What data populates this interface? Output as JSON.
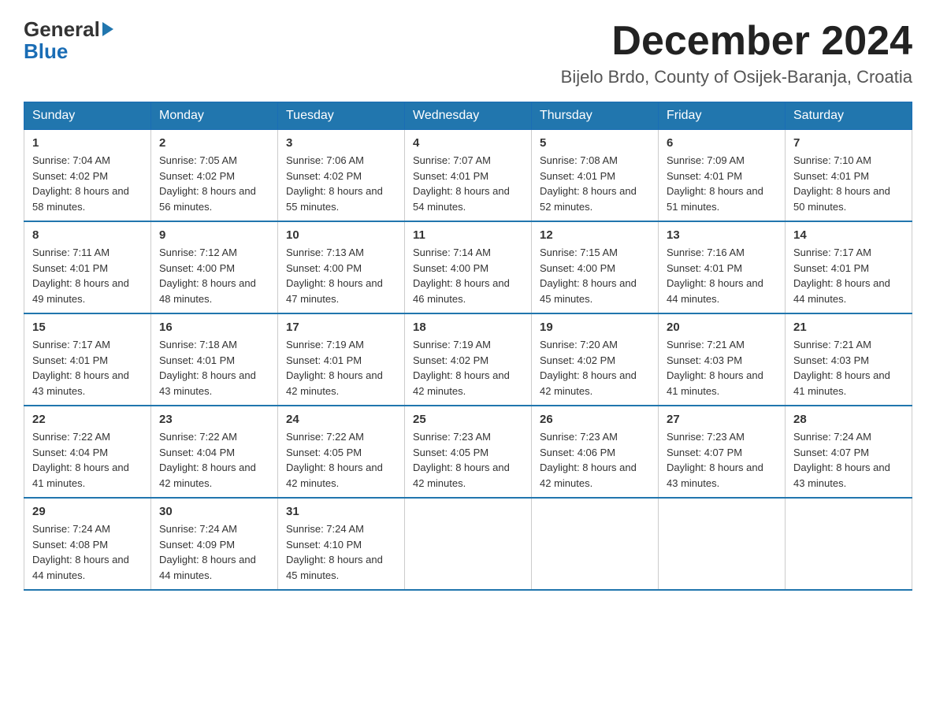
{
  "logo": {
    "line1": "General",
    "line2": "Blue"
  },
  "header": {
    "title": "December 2024",
    "subtitle": "Bijelo Brdo, County of Osijek-Baranja, Croatia"
  },
  "weekdays": [
    "Sunday",
    "Monday",
    "Tuesday",
    "Wednesday",
    "Thursday",
    "Friday",
    "Saturday"
  ],
  "weeks": [
    [
      {
        "day": "1",
        "sunrise": "Sunrise: 7:04 AM",
        "sunset": "Sunset: 4:02 PM",
        "daylight": "Daylight: 8 hours and 58 minutes."
      },
      {
        "day": "2",
        "sunrise": "Sunrise: 7:05 AM",
        "sunset": "Sunset: 4:02 PM",
        "daylight": "Daylight: 8 hours and 56 minutes."
      },
      {
        "day": "3",
        "sunrise": "Sunrise: 7:06 AM",
        "sunset": "Sunset: 4:02 PM",
        "daylight": "Daylight: 8 hours and 55 minutes."
      },
      {
        "day": "4",
        "sunrise": "Sunrise: 7:07 AM",
        "sunset": "Sunset: 4:01 PM",
        "daylight": "Daylight: 8 hours and 54 minutes."
      },
      {
        "day": "5",
        "sunrise": "Sunrise: 7:08 AM",
        "sunset": "Sunset: 4:01 PM",
        "daylight": "Daylight: 8 hours and 52 minutes."
      },
      {
        "day": "6",
        "sunrise": "Sunrise: 7:09 AM",
        "sunset": "Sunset: 4:01 PM",
        "daylight": "Daylight: 8 hours and 51 minutes."
      },
      {
        "day": "7",
        "sunrise": "Sunrise: 7:10 AM",
        "sunset": "Sunset: 4:01 PM",
        "daylight": "Daylight: 8 hours and 50 minutes."
      }
    ],
    [
      {
        "day": "8",
        "sunrise": "Sunrise: 7:11 AM",
        "sunset": "Sunset: 4:01 PM",
        "daylight": "Daylight: 8 hours and 49 minutes."
      },
      {
        "day": "9",
        "sunrise": "Sunrise: 7:12 AM",
        "sunset": "Sunset: 4:00 PM",
        "daylight": "Daylight: 8 hours and 48 minutes."
      },
      {
        "day": "10",
        "sunrise": "Sunrise: 7:13 AM",
        "sunset": "Sunset: 4:00 PM",
        "daylight": "Daylight: 8 hours and 47 minutes."
      },
      {
        "day": "11",
        "sunrise": "Sunrise: 7:14 AM",
        "sunset": "Sunset: 4:00 PM",
        "daylight": "Daylight: 8 hours and 46 minutes."
      },
      {
        "day": "12",
        "sunrise": "Sunrise: 7:15 AM",
        "sunset": "Sunset: 4:00 PM",
        "daylight": "Daylight: 8 hours and 45 minutes."
      },
      {
        "day": "13",
        "sunrise": "Sunrise: 7:16 AM",
        "sunset": "Sunset: 4:01 PM",
        "daylight": "Daylight: 8 hours and 44 minutes."
      },
      {
        "day": "14",
        "sunrise": "Sunrise: 7:17 AM",
        "sunset": "Sunset: 4:01 PM",
        "daylight": "Daylight: 8 hours and 44 minutes."
      }
    ],
    [
      {
        "day": "15",
        "sunrise": "Sunrise: 7:17 AM",
        "sunset": "Sunset: 4:01 PM",
        "daylight": "Daylight: 8 hours and 43 minutes."
      },
      {
        "day": "16",
        "sunrise": "Sunrise: 7:18 AM",
        "sunset": "Sunset: 4:01 PM",
        "daylight": "Daylight: 8 hours and 43 minutes."
      },
      {
        "day": "17",
        "sunrise": "Sunrise: 7:19 AM",
        "sunset": "Sunset: 4:01 PM",
        "daylight": "Daylight: 8 hours and 42 minutes."
      },
      {
        "day": "18",
        "sunrise": "Sunrise: 7:19 AM",
        "sunset": "Sunset: 4:02 PM",
        "daylight": "Daylight: 8 hours and 42 minutes."
      },
      {
        "day": "19",
        "sunrise": "Sunrise: 7:20 AM",
        "sunset": "Sunset: 4:02 PM",
        "daylight": "Daylight: 8 hours and 42 minutes."
      },
      {
        "day": "20",
        "sunrise": "Sunrise: 7:21 AM",
        "sunset": "Sunset: 4:03 PM",
        "daylight": "Daylight: 8 hours and 41 minutes."
      },
      {
        "day": "21",
        "sunrise": "Sunrise: 7:21 AM",
        "sunset": "Sunset: 4:03 PM",
        "daylight": "Daylight: 8 hours and 41 minutes."
      }
    ],
    [
      {
        "day": "22",
        "sunrise": "Sunrise: 7:22 AM",
        "sunset": "Sunset: 4:04 PM",
        "daylight": "Daylight: 8 hours and 41 minutes."
      },
      {
        "day": "23",
        "sunrise": "Sunrise: 7:22 AM",
        "sunset": "Sunset: 4:04 PM",
        "daylight": "Daylight: 8 hours and 42 minutes."
      },
      {
        "day": "24",
        "sunrise": "Sunrise: 7:22 AM",
        "sunset": "Sunset: 4:05 PM",
        "daylight": "Daylight: 8 hours and 42 minutes."
      },
      {
        "day": "25",
        "sunrise": "Sunrise: 7:23 AM",
        "sunset": "Sunset: 4:05 PM",
        "daylight": "Daylight: 8 hours and 42 minutes."
      },
      {
        "day": "26",
        "sunrise": "Sunrise: 7:23 AM",
        "sunset": "Sunset: 4:06 PM",
        "daylight": "Daylight: 8 hours and 42 minutes."
      },
      {
        "day": "27",
        "sunrise": "Sunrise: 7:23 AM",
        "sunset": "Sunset: 4:07 PM",
        "daylight": "Daylight: 8 hours and 43 minutes."
      },
      {
        "day": "28",
        "sunrise": "Sunrise: 7:24 AM",
        "sunset": "Sunset: 4:07 PM",
        "daylight": "Daylight: 8 hours and 43 minutes."
      }
    ],
    [
      {
        "day": "29",
        "sunrise": "Sunrise: 7:24 AM",
        "sunset": "Sunset: 4:08 PM",
        "daylight": "Daylight: 8 hours and 44 minutes."
      },
      {
        "day": "30",
        "sunrise": "Sunrise: 7:24 AM",
        "sunset": "Sunset: 4:09 PM",
        "daylight": "Daylight: 8 hours and 44 minutes."
      },
      {
        "day": "31",
        "sunrise": "Sunrise: 7:24 AM",
        "sunset": "Sunset: 4:10 PM",
        "daylight": "Daylight: 8 hours and 45 minutes."
      },
      null,
      null,
      null,
      null
    ]
  ]
}
